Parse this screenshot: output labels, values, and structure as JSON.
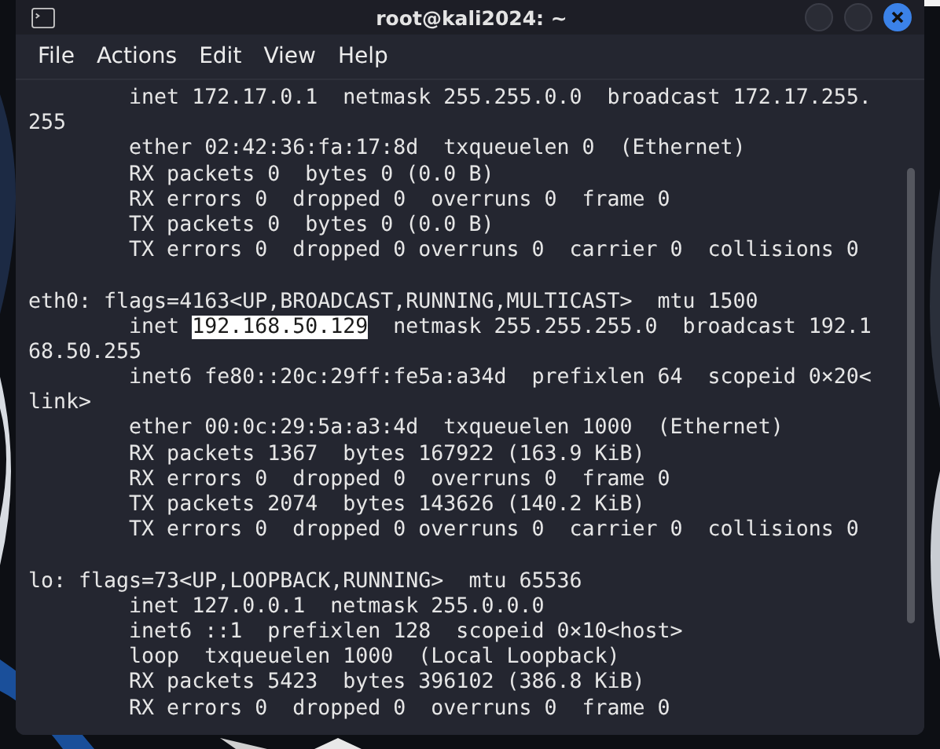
{
  "window": {
    "title": "root@kali2024: ~"
  },
  "menu": [
    {
      "label": "File"
    },
    {
      "label": "Actions"
    },
    {
      "label": "Edit"
    },
    {
      "label": "View"
    },
    {
      "label": "Help"
    }
  ],
  "terminal": {
    "lines": [
      {
        "kind": "text",
        "text": "        inet 172.17.0.1  netmask 255.255.0.0  broadcast 172.17.255."
      },
      {
        "kind": "text",
        "text": "255"
      },
      {
        "kind": "text",
        "text": "        ether 02:42:36:fa:17:8d  txqueuelen 0  (Ethernet)"
      },
      {
        "kind": "text",
        "text": "        RX packets 0  bytes 0 (0.0 B)"
      },
      {
        "kind": "text",
        "text": "        RX errors 0  dropped 0  overruns 0  frame 0"
      },
      {
        "kind": "text",
        "text": "        TX packets 0  bytes 0 (0.0 B)"
      },
      {
        "kind": "text",
        "text": "        TX errors 0  dropped 0 overruns 0  carrier 0  collisions 0"
      },
      {
        "kind": "blank"
      },
      {
        "kind": "text",
        "text": "eth0: flags=4163<UP,BROADCAST,RUNNING,MULTICAST>  mtu 1500"
      },
      {
        "kind": "segments",
        "segments": [
          {
            "text": "        inet ",
            "selected": false
          },
          {
            "text": "192.168.50.129",
            "selected": true
          },
          {
            "text": "  netmask 255.255.255.0  broadcast 192.1",
            "selected": false
          }
        ]
      },
      {
        "kind": "text",
        "text": "68.50.255"
      },
      {
        "kind": "text",
        "text": "        inet6 fe80::20c:29ff:fe5a:a34d  prefixlen 64  scopeid 0×20<"
      },
      {
        "kind": "text",
        "text": "link>"
      },
      {
        "kind": "text",
        "text": "        ether 00:0c:29:5a:a3:4d  txqueuelen 1000  (Ethernet)"
      },
      {
        "kind": "text",
        "text": "        RX packets 1367  bytes 167922 (163.9 KiB)"
      },
      {
        "kind": "text",
        "text": "        RX errors 0  dropped 0  overruns 0  frame 0"
      },
      {
        "kind": "text",
        "text": "        TX packets 2074  bytes 143626 (140.2 KiB)"
      },
      {
        "kind": "text",
        "text": "        TX errors 0  dropped 0 overruns 0  carrier 0  collisions 0"
      },
      {
        "kind": "blank"
      },
      {
        "kind": "text",
        "text": "lo: flags=73<UP,LOOPBACK,RUNNING>  mtu 65536"
      },
      {
        "kind": "text",
        "text": "        inet 127.0.0.1  netmask 255.0.0.0"
      },
      {
        "kind": "text",
        "text": "        inet6 ::1  prefixlen 128  scopeid 0×10<host>"
      },
      {
        "kind": "text",
        "text": "        loop  txqueuelen 1000  (Local Loopback)"
      },
      {
        "kind": "text",
        "text": "        RX packets 5423  bytes 396102 (386.8 KiB)"
      },
      {
        "kind": "text",
        "text": "        RX errors 0  dropped 0  overruns 0  frame 0"
      }
    ]
  }
}
